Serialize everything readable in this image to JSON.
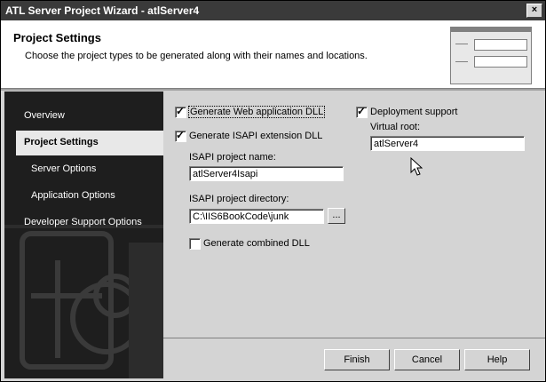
{
  "window": {
    "title": "ATL Server Project Wizard - atlServer4",
    "close_glyph": "×"
  },
  "header": {
    "title": "Project Settings",
    "subtitle": "Choose the project types to be generated along with their names and locations."
  },
  "sidebar": {
    "items": [
      {
        "label": "Overview",
        "active": false
      },
      {
        "label": "Project Settings",
        "active": true
      },
      {
        "label": "Server Options",
        "active": false
      },
      {
        "label": "Application Options",
        "active": false
      },
      {
        "label": "Developer Support Options",
        "active": false
      }
    ]
  },
  "settings": {
    "generate_web_dll": {
      "label": "Generate Web application DLL",
      "checked": true
    },
    "generate_isapi_dll": {
      "label": "Generate ISAPI extension DLL",
      "checked": true
    },
    "isapi_name": {
      "label": "ISAPI project name:",
      "value": "atlServer4Isapi"
    },
    "isapi_dir": {
      "label": "ISAPI project directory:",
      "value": "C:\\IIS6BookCode\\junk",
      "browse_label": "..."
    },
    "generate_combined": {
      "label": "Generate combined DLL",
      "checked": false
    },
    "deployment": {
      "label": "Deployment support",
      "checked": true
    },
    "virtual_root": {
      "label": "Virtual root:",
      "value": "atlServer4"
    }
  },
  "check_glyph": "✓",
  "buttons": {
    "finish": "Finish",
    "cancel": "Cancel",
    "help": "Help"
  },
  "colors": {
    "titlebar": "#3a3a3a",
    "sidebar": "#1e1e1e",
    "dialog": "#d4d4d4"
  }
}
